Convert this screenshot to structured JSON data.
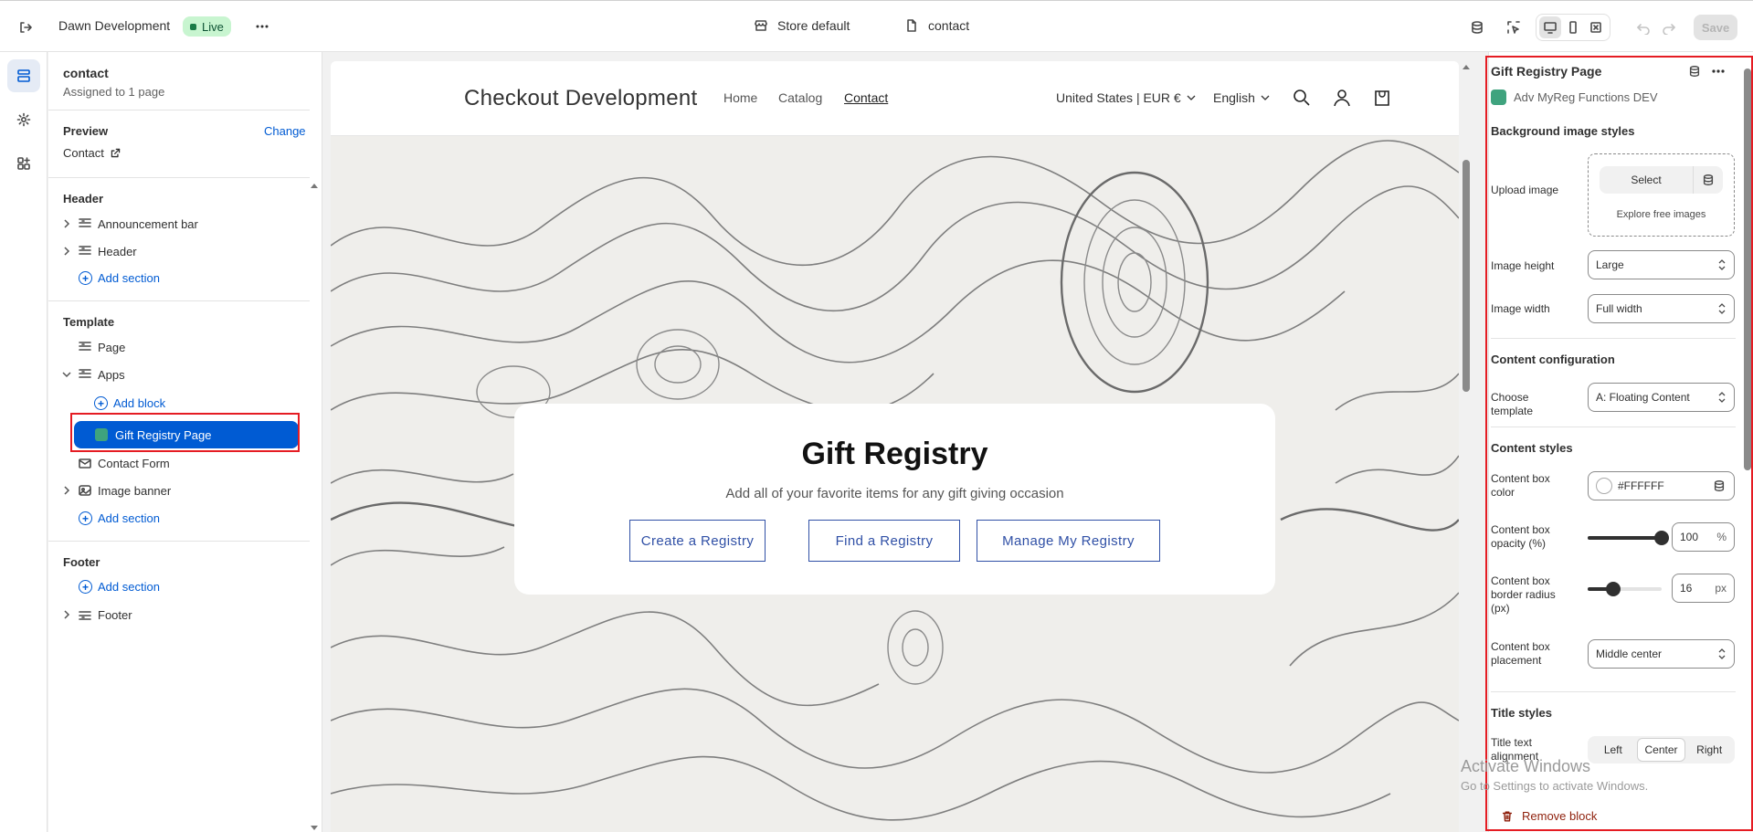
{
  "topbar": {
    "theme_name": "Dawn Development",
    "live_label": "Live",
    "store_context": "Store default",
    "page_context": "contact",
    "save_label": "Save"
  },
  "sidebar": {
    "template_title": "contact",
    "assigned": "Assigned to 1 page",
    "preview_label": "Preview",
    "change_label": "Change",
    "preview_page": "Contact",
    "header_group": {
      "title": "Header",
      "items": [
        "Announcement bar",
        "Header"
      ],
      "add_section": "Add section"
    },
    "template_group": {
      "title": "Template",
      "page": "Page",
      "apps": "Apps",
      "add_block": "Add block",
      "selected_block": "Gift Registry Page",
      "contact_form": "Contact Form",
      "image_banner": "Image banner",
      "add_section": "Add section"
    },
    "footer_group": {
      "title": "Footer",
      "add_section": "Add section",
      "footer": "Footer"
    }
  },
  "preview": {
    "store_logo": "Checkout Development",
    "nav": [
      "Home",
      "Catalog",
      "Contact"
    ],
    "locale": "United States | EUR €",
    "language": "English",
    "hero": {
      "title": "Gift Registry",
      "subtitle": "Add all of your favorite items for any gift giving occasion",
      "buttons": [
        "Create a Registry",
        "Find a Registry",
        "Manage My Registry"
      ]
    }
  },
  "settings": {
    "block_title": "Gift Registry Page",
    "app_name": "Adv MyReg Functions DEV",
    "bg_section": "Background image styles",
    "upload_label": "Upload image",
    "select_label": "Select",
    "explore_label": "Explore free images",
    "image_height_label": "Image height",
    "image_height": "Large",
    "image_width_label": "Image width",
    "image_width": "Full width",
    "content_config": "Content configuration",
    "choose_template_label": "Choose template",
    "choose_template": "A: Floating Content",
    "content_styles": "Content styles",
    "box_color_label": "Content box color",
    "box_color": "#FFFFFF",
    "opacity_label": "Content box opacity (%)",
    "opacity_value": "100",
    "opacity_unit": "%",
    "opacity_fraction": 1.0,
    "radius_label": "Content box border radius (px)",
    "radius_value": "16",
    "radius_unit": "px",
    "radius_fraction": 0.35,
    "placement_label": "Content box placement",
    "placement": "Middle center",
    "title_styles": "Title styles",
    "title_align_label": "Title text alignment",
    "align_options": [
      "Left",
      "Center",
      "Right"
    ],
    "align_selected": "Center",
    "remove_label": "Remove block"
  },
  "os_watermark": {
    "line1": "Activate Windows",
    "line2": "Go to Settings to activate Windows."
  },
  "colors": {
    "accent": "#005bd3",
    "highlight_outline": "#e51c23",
    "live_badge": "#c8f5d0",
    "hero_button": "#3050a6"
  }
}
